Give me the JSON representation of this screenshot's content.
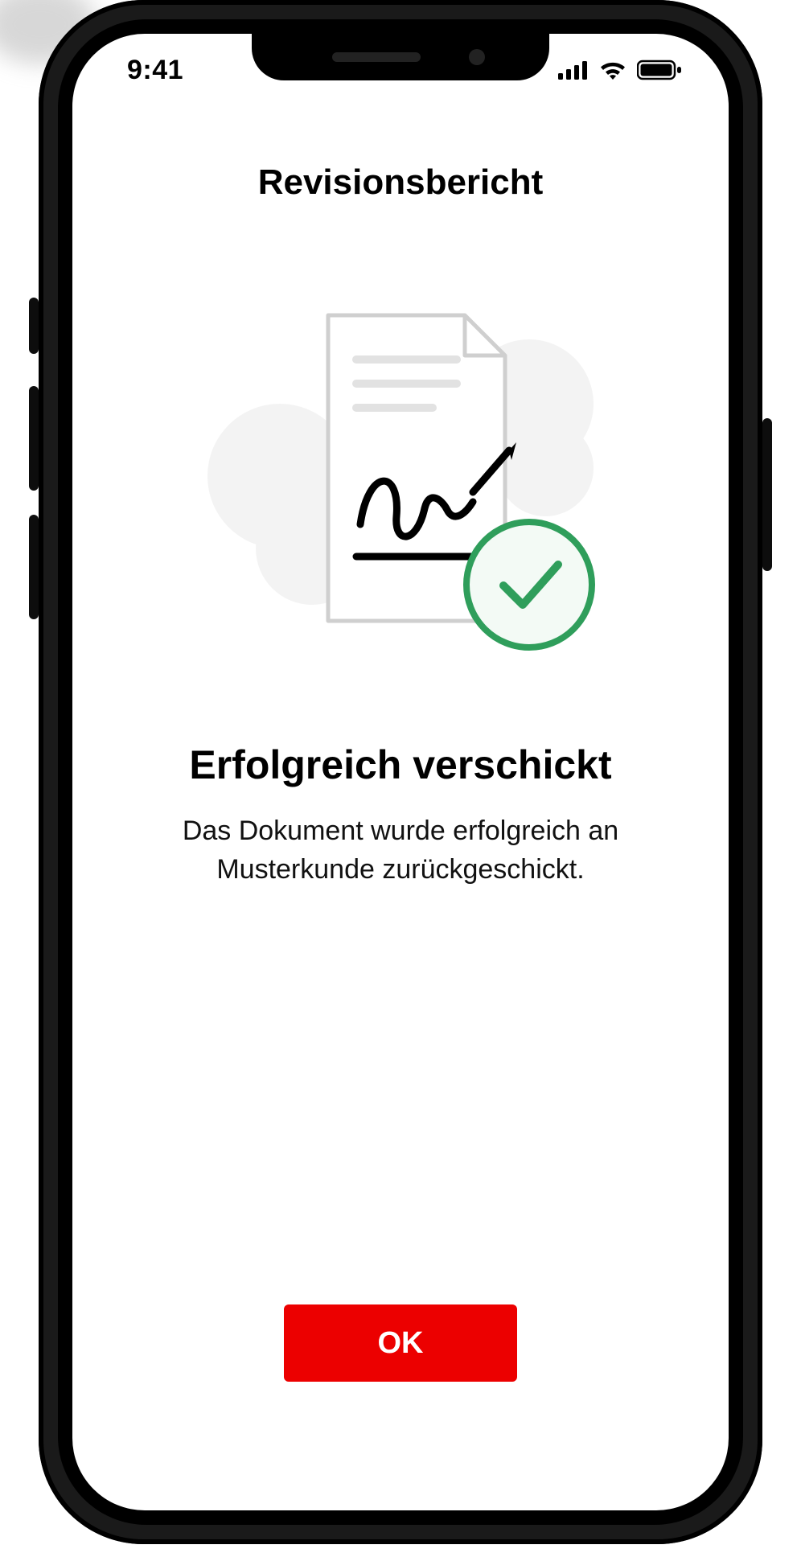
{
  "status": {
    "time": "9:41"
  },
  "header": {
    "title": "Revisionsbericht"
  },
  "success": {
    "headline": "Erfolgreich verschickt",
    "body": "Das Dokument wurde erfolgreich an Musterkunde zurückgeschickt."
  },
  "actions": {
    "ok_label": "OK"
  },
  "colors": {
    "primary": "#ec0000",
    "success": "#2f9e5b"
  }
}
